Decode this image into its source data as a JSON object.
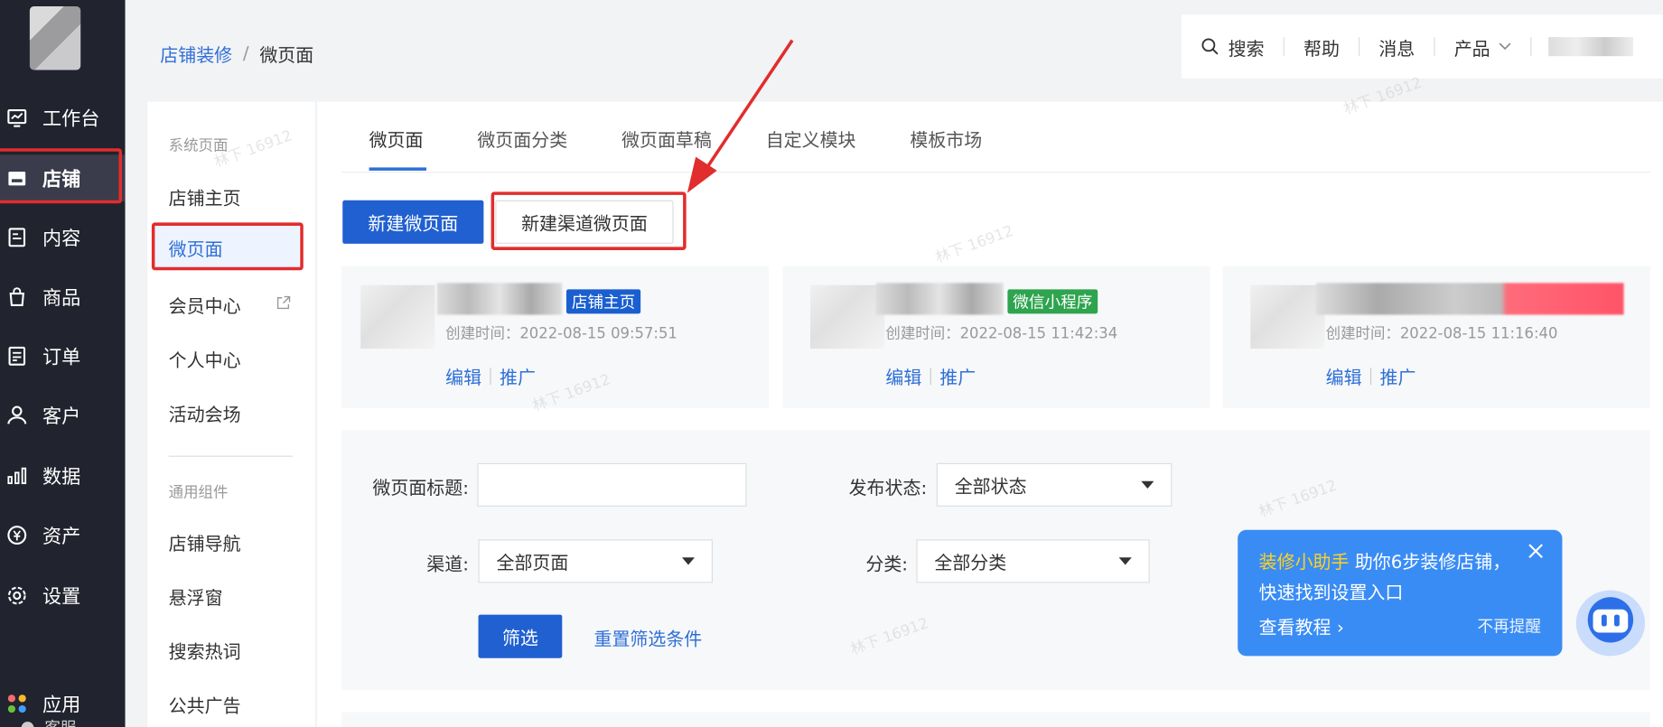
{
  "nav": {
    "items": [
      {
        "label": "工作台",
        "icon": "dashboard-icon"
      },
      {
        "label": "店铺",
        "icon": "store-icon"
      },
      {
        "label": "内容",
        "icon": "content-icon"
      },
      {
        "label": "商品",
        "icon": "bag-icon"
      },
      {
        "label": "订单",
        "icon": "order-icon"
      },
      {
        "label": "客户",
        "icon": "user-icon"
      },
      {
        "label": "数据",
        "icon": "chart-icon"
      },
      {
        "label": "资产",
        "icon": "asset-icon"
      },
      {
        "label": "设置",
        "icon": "gear-icon"
      },
      {
        "label": "应用",
        "icon": "apps-icon"
      }
    ],
    "partial": "客服"
  },
  "breadcrumb": {
    "parent": "店铺装修",
    "sep": "/",
    "current": "微页面"
  },
  "topbar": {
    "search": "搜索",
    "help": "帮助",
    "messages": "消息",
    "products": "产品"
  },
  "subnav": {
    "group1": "系统页面",
    "items1": [
      "店铺主页",
      "微页面",
      "会员中心",
      "个人中心",
      "活动会场"
    ],
    "group2": "通用组件",
    "items2": [
      "店铺导航",
      "悬浮窗",
      "搜索热词",
      "公共广告"
    ]
  },
  "tabs": [
    "微页面",
    "微页面分类",
    "微页面草稿",
    "自定义模块",
    "模板市场"
  ],
  "buttons": {
    "new_page": "新建微页面",
    "new_channel_page": "新建渠道微页面"
  },
  "cards": [
    {
      "tag": "店铺主页",
      "tag_color": "#1a5fd0",
      "time": "创建时间：2022-08-15 09:57:51",
      "edit": "编辑",
      "promote": "推广"
    },
    {
      "tag": "微信小程序",
      "tag_color": "#2ea44f",
      "time": "创建时间：2022-08-15 11:42:34",
      "edit": "编辑",
      "promote": "推广"
    },
    {
      "tag": "",
      "tag_color": "",
      "time": "创建时间：2022-08-15 11:16:40",
      "edit": "编辑",
      "promote": "推广"
    }
  ],
  "filter": {
    "title_label": "微页面标题:",
    "status_label": "发布状态:",
    "status_value": "全部状态",
    "channel_label": "渠道:",
    "channel_value": "全部页面",
    "category_label": "分类:",
    "category_value": "全部分类",
    "submit": "筛选",
    "reset": "重置筛选条件"
  },
  "helper": {
    "highlight": "装修小助手",
    "text1": " 助你6步装修店铺，",
    "text2": "快速找到设置入口",
    "tutorial": "查看教程 ›",
    "dismiss": "不再提醒"
  },
  "watermark": "林下 16912",
  "colors": {
    "primary": "#2060d0",
    "annotation": "#e12d2d"
  }
}
